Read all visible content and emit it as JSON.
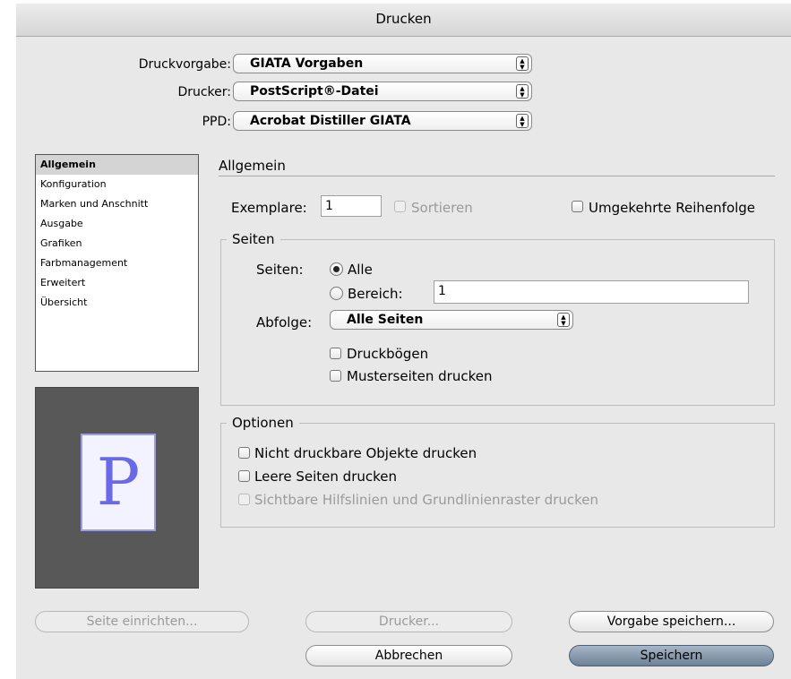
{
  "window": {
    "title": "Drucken"
  },
  "header": {
    "preset_label": "Druckvorgabe:",
    "preset_value": "GIATA Vorgaben",
    "printer_label": "Drucker:",
    "printer_value": "PostScript®-Datei",
    "ppd_label": "PPD:",
    "ppd_value": "Acrobat Distiller GIATA"
  },
  "sidebar": {
    "items": [
      {
        "label": "Allgemein",
        "selected": true
      },
      {
        "label": "Konfiguration"
      },
      {
        "label": "Marken und Anschnitt"
      },
      {
        "label": "Ausgabe"
      },
      {
        "label": "Grafiken"
      },
      {
        "label": "Farbmanagement"
      },
      {
        "label": "Erweitert"
      },
      {
        "label": "Übersicht"
      }
    ]
  },
  "preview": {
    "glyph": "P"
  },
  "main": {
    "section_title": "Allgemein",
    "copies_label": "Exemplare:",
    "copies_value": "1",
    "collate_label": "Sortieren",
    "reverse_label": "Umgekehrte Reihenfolge"
  },
  "pages_group": {
    "title": "Seiten",
    "pages_label": "Seiten:",
    "all_label": "Alle",
    "range_label": "Bereich:",
    "range_value": "1",
    "sequence_label": "Abfolge:",
    "sequence_value": "Alle Seiten",
    "spreads_label": "Druckbögen",
    "master_label": "Musterseiten drucken"
  },
  "options_group": {
    "title": "Optionen",
    "nonprinting_label": "Nicht druckbare Objekte drucken",
    "blank_label": "Leere Seiten drucken",
    "guides_label": "Sichtbare Hilfslinien und Grundlinienraster drucken"
  },
  "buttons": {
    "page_setup": "Seite einrichten...",
    "printer": "Drucker...",
    "save_preset": "Vorgabe speichern...",
    "cancel": "Abbrechen",
    "save": "Speichern"
  }
}
